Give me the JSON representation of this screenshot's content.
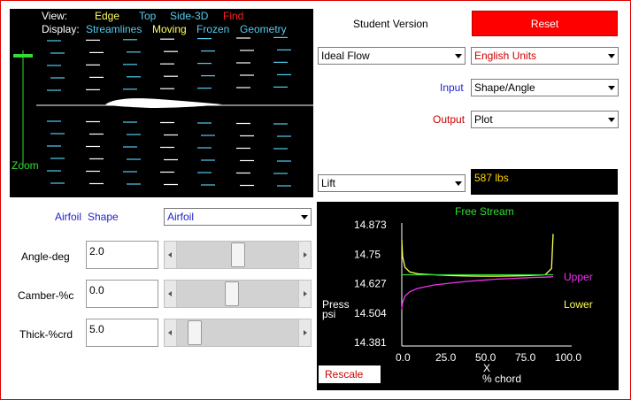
{
  "view_panel": {
    "view_label": "View:",
    "view_options": [
      {
        "label": "Edge",
        "color": "#ffff66"
      },
      {
        "label": "Top",
        "color": "#55ccee"
      },
      {
        "label": "Side-3D",
        "color": "#55ccee"
      },
      {
        "label": "Find",
        "color": "#ff2020"
      }
    ],
    "display_label": "Display:",
    "display_options": [
      {
        "label": "Streamlines",
        "color": "#55ccee"
      },
      {
        "label": "Moving",
        "color": "#ffff66"
      },
      {
        "label": "Frozen",
        "color": "#55ccee"
      },
      {
        "label": "Geometry",
        "color": "#55ccee"
      }
    ],
    "zoom_label": "Zoom"
  },
  "header": {
    "version_label": "Student Version",
    "reset_label": "Reset"
  },
  "flow_select": {
    "value": "Ideal Flow"
  },
  "units_select": {
    "value": "English Units"
  },
  "input_row": {
    "label": "Input",
    "value": "Shape/Angle"
  },
  "output_row": {
    "label": "Output",
    "value": "Plot"
  },
  "result_select": {
    "value": "Lift"
  },
  "result_value": "587 lbs",
  "shape_panel": {
    "airfoil_label": "Airfoil",
    "shape_label": "Shape",
    "shape_select": "Airfoil",
    "params": [
      {
        "label": "Angle-deg",
        "value": "2.0",
        "slider_fraction": 0.5
      },
      {
        "label": "Camber-%c",
        "value": "0.0",
        "slider_fraction": 0.45
      },
      {
        "label": "Thick-%crd",
        "value": "5.0",
        "slider_fraction": 0.1
      }
    ]
  },
  "plot_panel": {
    "rescale_label": "Rescale"
  },
  "chart_data": {
    "type": "line",
    "title": "Free Stream",
    "ylabel": "Press\npsi",
    "xlabel": "X\n% chord",
    "x_ticks": [
      "0.0",
      "25.0",
      "50.0",
      "75.0",
      "100.0"
    ],
    "y_ticks": [
      "14.873",
      "14.75",
      "14.627",
      "14.504",
      "14.381"
    ],
    "xlim": [
      0,
      100
    ],
    "ylim": [
      14.381,
      14.873
    ],
    "colors": {
      "free_stream": "#33dd33",
      "upper": "#ee33ee",
      "lower": "#ffff55"
    },
    "legend": [
      "Upper",
      "Lower"
    ],
    "series": [
      {
        "name": "Upper",
        "x": [
          0,
          0.5,
          2,
          5,
          10,
          20,
          30,
          40,
          50,
          60,
          70,
          80,
          90,
          95
        ],
        "y": [
          14.52,
          14.548,
          14.575,
          14.593,
          14.607,
          14.621,
          14.629,
          14.636,
          14.641,
          14.646,
          14.649,
          14.652,
          14.654,
          14.656
        ]
      },
      {
        "name": "Lower",
        "x": [
          0,
          0.5,
          2,
          5,
          10,
          20,
          30,
          40,
          50,
          60,
          70,
          80,
          90,
          94,
          95
        ],
        "y": [
          14.81,
          14.74,
          14.695,
          14.676,
          14.668,
          14.664,
          14.661,
          14.659,
          14.658,
          14.658,
          14.659,
          14.661,
          14.664,
          14.69,
          14.835
        ]
      },
      {
        "name": "Free Stream",
        "x": [
          0,
          10,
          30,
          50,
          70,
          90,
          95
        ],
        "y": [
          14.664,
          14.664,
          14.664,
          14.664,
          14.664,
          14.664,
          14.664
        ]
      }
    ]
  }
}
